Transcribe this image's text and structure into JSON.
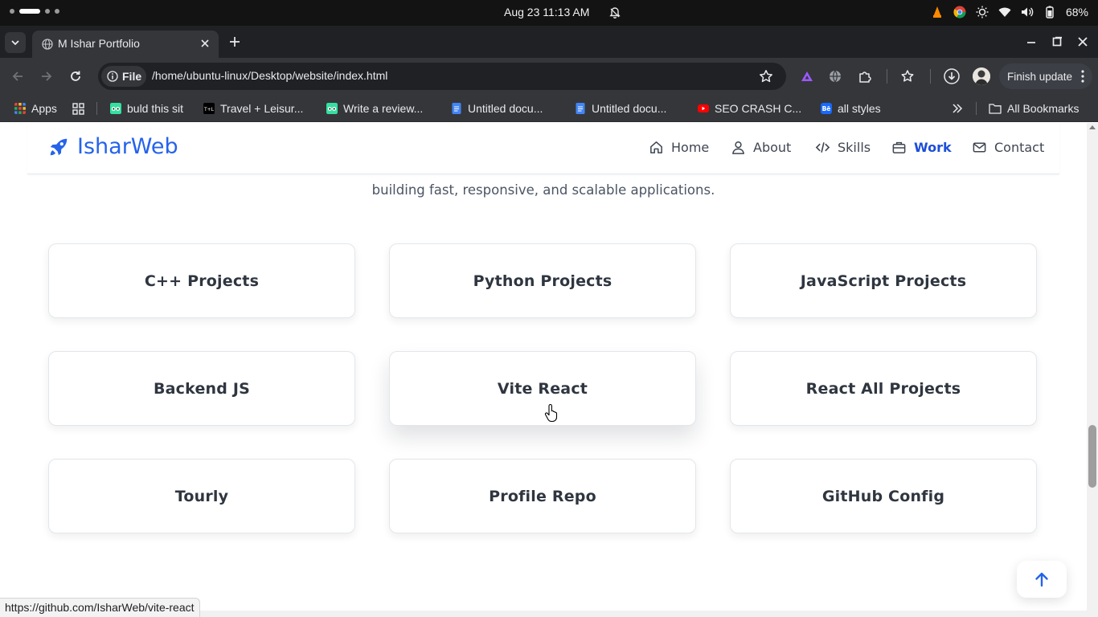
{
  "os": {
    "clock": "Aug 23  11:13 AM",
    "battery": "68%"
  },
  "browser": {
    "tab_title": "M Ishar Portfolio",
    "url_chip": "File",
    "url": "/home/ubuntu-linux/Desktop/website/index.html",
    "finish_update": "Finish update",
    "bookmarks": [
      {
        "label": "Apps",
        "icon": "apps-grid-icon",
        "color": "#e8453c"
      },
      {
        "label": "buld this sit",
        "icon": "tripadvisor-icon",
        "color": "#34e0a1"
      },
      {
        "label": "Travel + Leisur...",
        "icon": "tl-icon",
        "color": "#000000"
      },
      {
        "label": "Write a review...",
        "icon": "tripadvisor-icon",
        "color": "#34e0a1"
      },
      {
        "label": "Untitled docu...",
        "icon": "docs-icon",
        "color": "#4285f4"
      },
      {
        "label": "Untitled docu...",
        "icon": "docs-icon",
        "color": "#4285f4"
      },
      {
        "label": "SEO CRASH C...",
        "icon": "youtube-icon",
        "color": "#ff0000"
      },
      {
        "label": "all styles",
        "icon": "behance-icon",
        "color": "#1769ff"
      }
    ],
    "all_bookmarks": "All Bookmarks",
    "status_url": "https://github.com/IsharWeb/vite-react"
  },
  "site": {
    "brand": "IsharWeb",
    "accent": "#2563eb",
    "nav": [
      {
        "label": "Home",
        "icon": "home-icon"
      },
      {
        "label": "About",
        "icon": "user-icon"
      },
      {
        "label": "Skills",
        "icon": "code-icon"
      },
      {
        "label": "Work",
        "icon": "briefcase-icon",
        "active": true
      },
      {
        "label": "Contact",
        "icon": "mail-icon"
      }
    ],
    "intro_line": "building fast, responsive, and scalable applications.",
    "cards": [
      "C++ Projects",
      "Python Projects",
      "JavaScript Projects",
      "Backend JS",
      "Vite React",
      "React All Projects",
      "Tourly",
      "Profile Repo",
      "GitHub Config"
    ],
    "hovered_card": "Vite React"
  }
}
